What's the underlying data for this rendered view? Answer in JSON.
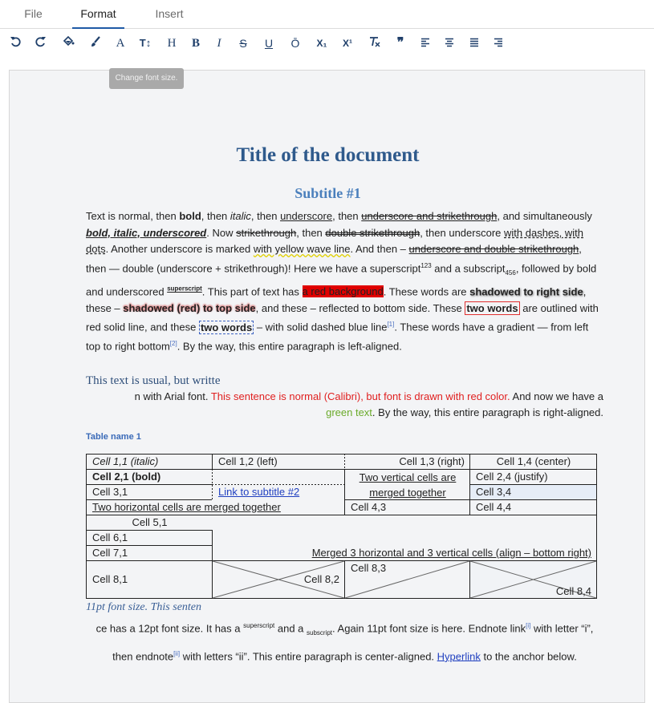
{
  "tabs": [
    {
      "label": "File"
    },
    {
      "label": "Format"
    },
    {
      "label": "Insert"
    }
  ],
  "active_tab": "Format",
  "toolbar": {
    "font_glyph": "A",
    "font_size_glyph": "T↕",
    "heading_glyph": "H",
    "bold_glyph": "B",
    "italic_glyph": "I",
    "strike_glyph": "S",
    "underline_glyph": "U",
    "overline_glyph": "Ō",
    "subscript_glyph": "X₁",
    "superscript_glyph": "X¹",
    "quote_glyph": "❞",
    "tooltip": "Change font size."
  },
  "doc": {
    "title": "Title of the document",
    "subtitle": "Subtitle #1",
    "p1": {
      "a": "Text is normal, then ",
      "bold": "bold",
      "b": ", then ",
      "italic": "italic",
      "c": ", then ",
      "underscore": "underscore",
      "d": ", then ",
      "underscore_strike": "underscore and strikethrough",
      "e": ", and simultaneously ",
      "bui": "bold, italic, underscored",
      "f": ". Now ",
      "strike": "strikethrough",
      "g": ", then ",
      "double_strike": "double strikethrough",
      "h": ", then underscore ",
      "dashes_dots": "with dashes, with dots",
      "i": ". Another underscore is marked ",
      "wave": "with yellow wave line",
      "j": ". And then – ",
      "ul_dstrike": "underscore and double strikethrough",
      "k": ", then — ",
      "double_combo": "double (underscore + strikethrough)",
      "l": "! Here we have a superscript",
      "sup1": "123",
      "m": " and a subscript",
      "sub1": "456",
      "n": ", followed by bold and underscored ",
      "sup2": "superscript",
      "o": ". This part of text has ",
      "redbg": "a red background",
      "p": ". These words are ",
      "shadow_right": "shadowed to right side",
      "q": ", these – ",
      "shadow_top": "shadowed (red) to top side",
      "r": ", and these – reflected to bottom side. These ",
      "outlined": "two words",
      "s": " are outlined with red solid line, and these ",
      "dashed": "two words",
      "t": " – with solid dashed blue line",
      "fn1": "[1]",
      "u": ". These words have a gradient — from left top to right bottom",
      "fn2": "[2]",
      "v": ". By the way, this entire paragraph is left-aligned."
    },
    "p2": {
      "serif_part": "This text is usual, but writte",
      "arial_part": "n with Arial font. ",
      "red_part": "This sentence is normal (Calibri), but font is drawn with red color.",
      "after_red": " And now we have a ",
      "green_part": "green text",
      "tail": ". By the way, this entire paragraph is right-aligned."
    },
    "table_name": "Table name 1",
    "table": {
      "c11": "Cell 1,1 (italic)",
      "c12": "Cell 1,2 (left)",
      "c13": "Cell 1,3 (right)",
      "c14": "Cell 1,4 (center)",
      "c21": "Cell 2,1 (bold)",
      "c23": "Two vertical cells are merged together",
      "c24": "Cell 2,4 (justify)",
      "c31": "Cell 3,1",
      "c32_link": "Link to subtitle #2",
      "c34": "Cell 3,4",
      "c41": "Two horizontal cells are merged together",
      "c43": "Cell 4,3",
      "c44": "Cell 4,4",
      "c51": "Cell 5,1",
      "c61": "Cell 6,1",
      "c71": "Cell 7,1",
      "merged": "Merged 3 horizontal and 3 vertical cells (align – bottom right)",
      "c81": "Cell 8,1",
      "c82": "Cell 8,2",
      "c83": "Cell 8,3",
      "c84": "Cell 8,4"
    },
    "p3": {
      "italic_part": "11pt font size. This senten",
      "a": "ce has a 12pt font size. It has a ",
      "sup": "superscript",
      "b": " and a ",
      "sub": "subscript",
      "c": ". Again 11pt font size is here. Endnote link",
      "fn_i": "[i]",
      "d": " with letter “i”, then endnote",
      "fn_ii": "[ii]",
      "e": " with letters “ii”. This entire paragraph is center-aligned. ",
      "hyperlink": "Hyperlink",
      "f": " to the anchor below."
    }
  },
  "colors": {
    "title": "#2f5a8c",
    "subtitle": "#4a7fbc",
    "red_text": "#e02020",
    "green_text": "#6aaa2a",
    "link": "#2040c0",
    "red_background": "#e00000"
  }
}
